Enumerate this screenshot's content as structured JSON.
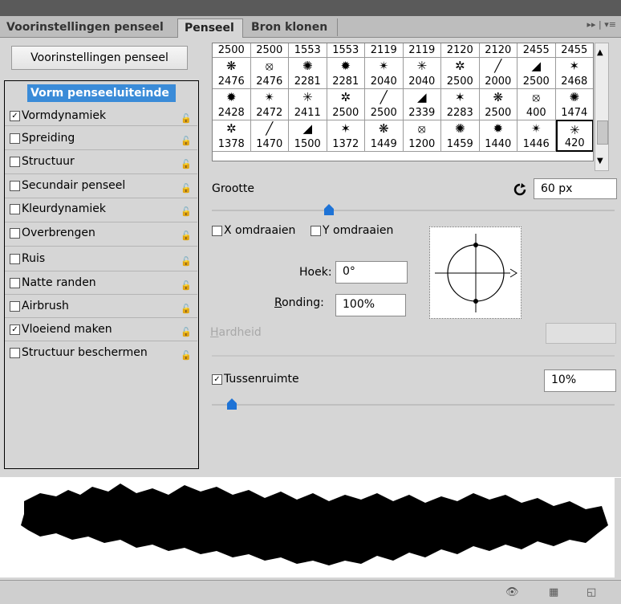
{
  "tabs": [
    {
      "label": "Voorinstellingen penseel"
    },
    {
      "label": "Penseel"
    },
    {
      "label": "Bron klonen"
    }
  ],
  "tab_controls": "▸▸ | ▾≡",
  "preset_button": "Voorinstellingen penseel",
  "options": {
    "shape_title": "Vorm penseeluiteinde",
    "items": [
      {
        "label": "Vormdynamiek",
        "checked": true
      },
      {
        "label": "Spreiding",
        "checked": false
      },
      {
        "label": "Structuur",
        "checked": false
      },
      {
        "label": "Secundair penseel",
        "checked": false
      },
      {
        "label": "Kleurdynamiek",
        "checked": false
      },
      {
        "label": "Overbrengen",
        "checked": false
      },
      {
        "label": "Ruis",
        "checked": false
      },
      {
        "label": "Natte randen",
        "checked": false
      },
      {
        "label": "Airbrush",
        "checked": false
      },
      {
        "label": "Vloeiend maken",
        "checked": true
      },
      {
        "label": "Structuur beschermen",
        "checked": false
      }
    ]
  },
  "brush_grid": {
    "rows": [
      [
        "2500",
        "2500",
        "1553",
        "1553",
        "2119",
        "2119",
        "2120",
        "2120",
        "2455",
        "2455"
      ],
      [
        "2476",
        "2476",
        "2281",
        "2281",
        "2040",
        "2040",
        "2500",
        "2000",
        "2500",
        "2468"
      ],
      [
        "2428",
        "2472",
        "2411",
        "2500",
        "2500",
        "2339",
        "2283",
        "2500",
        "400",
        "1474"
      ],
      [
        "1378",
        "1470",
        "1500",
        "1372",
        "1449",
        "1200",
        "1459",
        "1440",
        "1446",
        "420"
      ]
    ]
  },
  "size": {
    "label": "Grootte",
    "value": "60 px",
    "slider_fraction": 0.29
  },
  "flip": {
    "x_label": "X omdraaien",
    "y_label": "Y omdraaien",
    "x_checked": false,
    "y_checked": false
  },
  "angle": {
    "label": "Hoek:",
    "value": "0°"
  },
  "roundness": {
    "label": "Ronding:",
    "value": "100%"
  },
  "hardness": {
    "label": "Hardheid",
    "value": ""
  },
  "spacing": {
    "label": "Tussenruimte",
    "value": "10%",
    "checked": true,
    "slider_fraction": 0.05
  },
  "icons": {
    "reset": "reset-icon",
    "lock": "lock-icon",
    "eye": "eye-icon",
    "new": "new-preset-icon",
    "grid": "grid-icon"
  },
  "colors": {
    "selected": "#3a8bd8",
    "handle": "#1e73d6"
  }
}
